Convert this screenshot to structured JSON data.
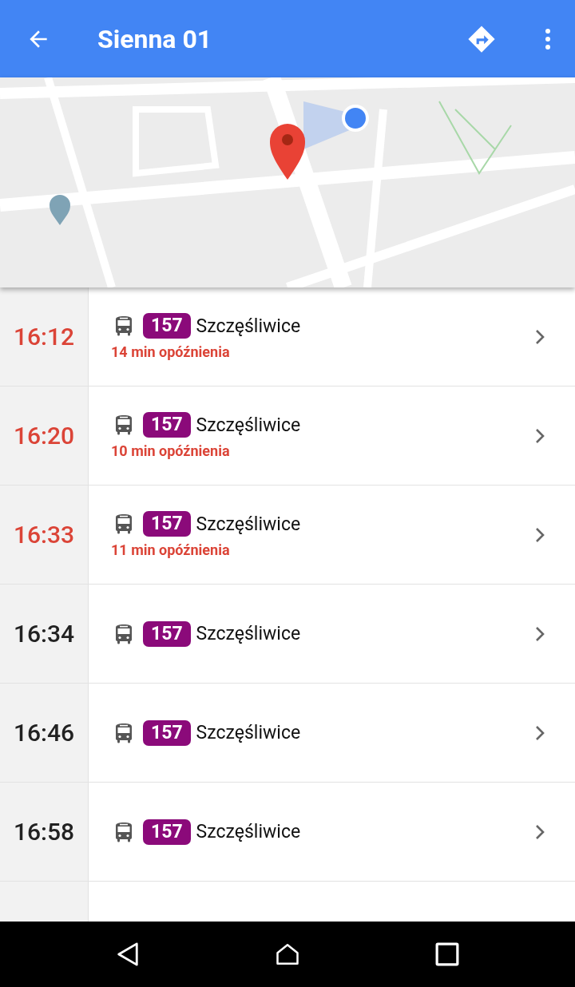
{
  "app_bar": {
    "title": "Sienna 01"
  },
  "departures": [
    {
      "time": "16:12",
      "line": "157",
      "destination": "Szczęśliwice",
      "delayed": true,
      "delay": "14 min opóźnienia"
    },
    {
      "time": "16:20",
      "line": "157",
      "destination": "Szczęśliwice",
      "delayed": true,
      "delay": "10 min opóźnienia"
    },
    {
      "time": "16:33",
      "line": "157",
      "destination": "Szczęśliwice",
      "delayed": true,
      "delay": "11 min opóźnienia"
    },
    {
      "time": "16:34",
      "line": "157",
      "destination": "Szczęśliwice",
      "delayed": false
    },
    {
      "time": "16:46",
      "line": "157",
      "destination": "Szczęśliwice",
      "delayed": false
    },
    {
      "time": "16:58",
      "line": "157",
      "destination": "Szczęśliwice",
      "delayed": false
    }
  ]
}
